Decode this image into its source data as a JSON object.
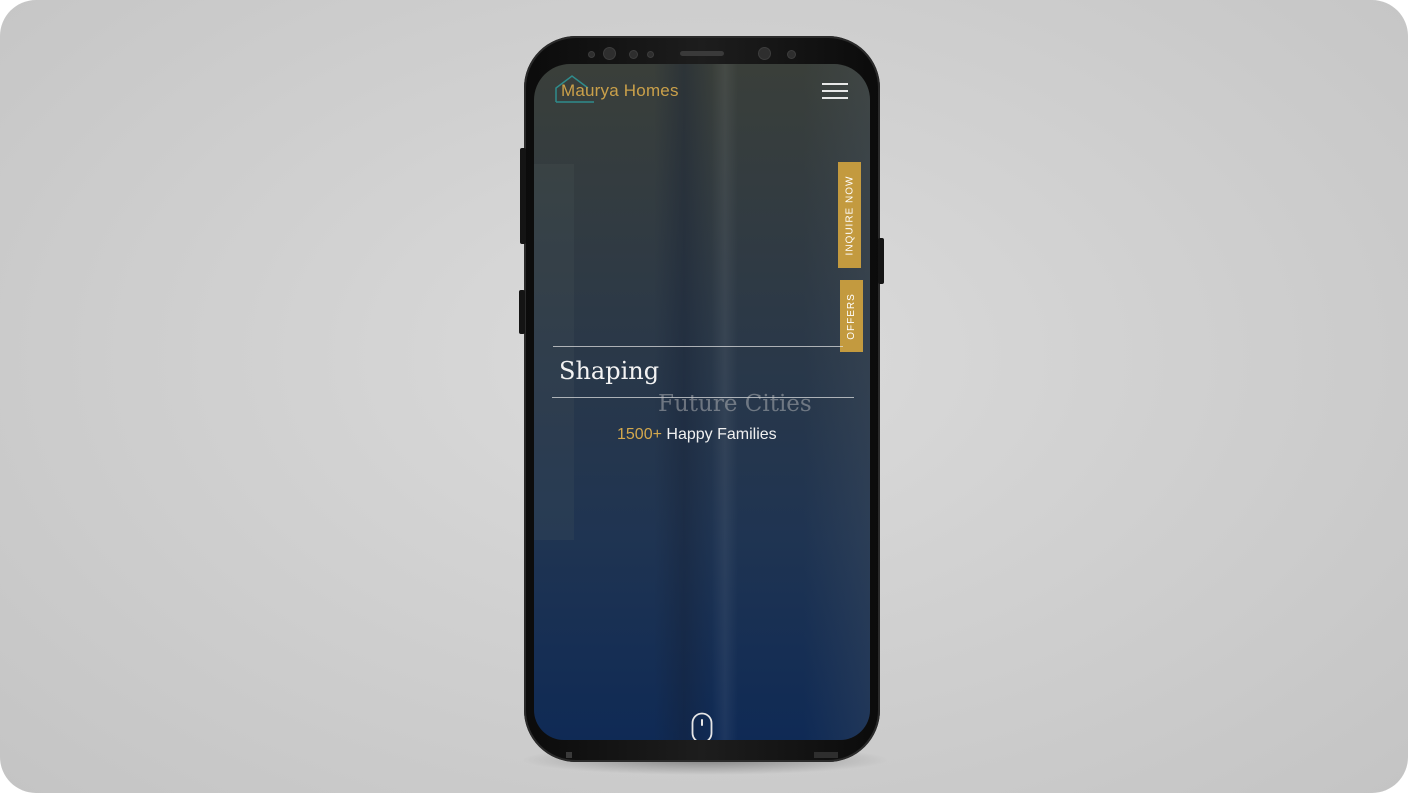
{
  "app": {
    "brand_name": "Maurya Homes",
    "accent_color": "#c39a3f"
  },
  "header": {
    "logo_icon": "house-outline-icon",
    "menu_icon": "hamburger-menu-icon"
  },
  "side_tabs": [
    {
      "label": "INQUIRE NOW"
    },
    {
      "label": "OFFERS"
    }
  ],
  "hero": {
    "title": "Shaping",
    "subtitle": "Future Cities",
    "stat_count": "1500+",
    "stat_label": " Happy Families"
  },
  "footer": {
    "scroll_icon": "mouse-scroll-icon"
  }
}
